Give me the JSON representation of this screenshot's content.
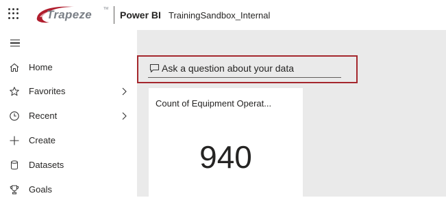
{
  "header": {
    "logo_text": "Trapeze",
    "logo_tm": "TM",
    "app_title": "Power BI",
    "workspace": "TrainingSandbox_Internal"
  },
  "sidebar": {
    "items": [
      {
        "label": "Home",
        "icon": "home-icon"
      },
      {
        "label": "Favorites",
        "icon": "star-icon",
        "has_chevron": true
      },
      {
        "label": "Recent",
        "icon": "clock-icon",
        "has_chevron": true
      },
      {
        "label": "Create",
        "icon": "plus-icon"
      },
      {
        "label": "Datasets",
        "icon": "database-icon"
      },
      {
        "label": "Goals",
        "icon": "trophy-icon"
      }
    ]
  },
  "qa": {
    "prompt": "Ask a question about your data",
    "highlight_color": "#a4262c"
  },
  "tile": {
    "title": "Count of Equipment Operat...",
    "value": "940"
  }
}
